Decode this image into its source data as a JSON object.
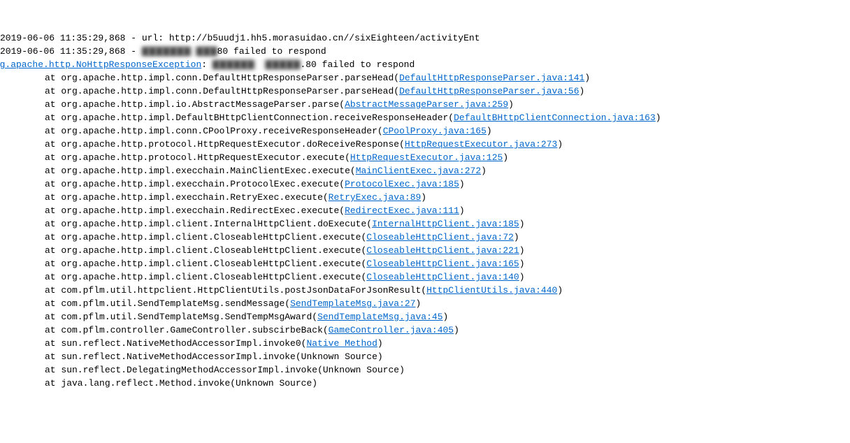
{
  "log": {
    "line0": {
      "text": "2019-06-06 11:35:29,868 - url: http://b5uudj1.hh5.morasuidao.cn//sixEighteen/activityEnt"
    },
    "line1": {
      "prefix": "2019-06-06 11:35:29,868 - ",
      "masked": "▇▇▇▇▇▇▇ ▇▇▇",
      "suffix": "80 failed to respond"
    },
    "line2": {
      "exLink": "org.apache.http.NoHttpResponseException",
      "colon": ": ",
      "masked": "▇▇▇▇▇▇  ▇▇▇▇▇",
      "suffix": ".80 failed to respond"
    }
  },
  "stack": [
    {
      "pre": "at org.apache.http.impl.conn.DefaultHttpResponseParser.parseHead(",
      "link": "DefaultHttpResponseParser.java:141",
      "post": ")"
    },
    {
      "pre": "at org.apache.http.impl.conn.DefaultHttpResponseParser.parseHead(",
      "link": "DefaultHttpResponseParser.java:56",
      "post": ")"
    },
    {
      "pre": "at org.apache.http.impl.io.AbstractMessageParser.parse(",
      "link": "AbstractMessageParser.java:259",
      "post": ")"
    },
    {
      "pre": "at org.apache.http.impl.DefaultBHttpClientConnection.receiveResponseHeader(",
      "link": "DefaultBHttpClientConnection.java:163",
      "post": ")"
    },
    {
      "pre": "at org.apache.http.impl.conn.CPoolProxy.receiveResponseHeader(",
      "link": "CPoolProxy.java:165",
      "post": ")"
    },
    {
      "pre": "at org.apache.http.protocol.HttpRequestExecutor.doReceiveResponse(",
      "link": "HttpRequestExecutor.java:273",
      "post": ")"
    },
    {
      "pre": "at org.apache.http.protocol.HttpRequestExecutor.execute(",
      "link": "HttpRequestExecutor.java:125",
      "post": ")"
    },
    {
      "pre": "at org.apache.http.impl.execchain.MainClientExec.execute(",
      "link": "MainClientExec.java:272",
      "post": ")"
    },
    {
      "pre": "at org.apache.http.impl.execchain.ProtocolExec.execute(",
      "link": "ProtocolExec.java:185",
      "post": ")"
    },
    {
      "pre": "at org.apache.http.impl.execchain.RetryExec.execute(",
      "link": "RetryExec.java:89",
      "post": ")"
    },
    {
      "pre": "at org.apache.http.impl.execchain.RedirectExec.execute(",
      "link": "RedirectExec.java:111",
      "post": ")"
    },
    {
      "pre": "at org.apache.http.impl.client.InternalHttpClient.doExecute(",
      "link": "InternalHttpClient.java:185",
      "post": ")"
    },
    {
      "pre": "at org.apache.http.impl.client.CloseableHttpClient.execute(",
      "link": "CloseableHttpClient.java:72",
      "post": ")"
    },
    {
      "pre": "at org.apache.http.impl.client.CloseableHttpClient.execute(",
      "link": "CloseableHttpClient.java:221",
      "post": ")"
    },
    {
      "pre": "at org.apache.http.impl.client.CloseableHttpClient.execute(",
      "link": "CloseableHttpClient.java:165",
      "post": ")"
    },
    {
      "pre": "at org.apache.http.impl.client.CloseableHttpClient.execute(",
      "link": "CloseableHttpClient.java:140",
      "post": ")"
    },
    {
      "pre": "at com.pflm.util.httpclient.HttpClientUtils.postJsonDataForJsonResult(",
      "link": "HttpClientUtils.java:440",
      "post": ")"
    },
    {
      "pre": "at com.pflm.util.SendTemplateMsg.sendMessage(",
      "link": "SendTemplateMsg.java:27",
      "post": ")"
    },
    {
      "pre": "at com.pflm.util.SendTemplateMsg.SendTempMsgAward(",
      "link": "SendTemplateMsg.java:45",
      "post": ")"
    },
    {
      "pre": "at com.pflm.controller.GameController.subscirbeBack(",
      "link": "GameController.java:405",
      "post": ")"
    },
    {
      "pre": "at sun.reflect.NativeMethodAccessorImpl.invoke0(",
      "link": "Native Method",
      "post": ")"
    },
    {
      "pre": "at sun.reflect.NativeMethodAccessorImpl.invoke(Unknown Source)",
      "link": "",
      "post": ""
    },
    {
      "pre": "at sun.reflect.DelegatingMethodAccessorImpl.invoke(Unknown Source)",
      "link": "",
      "post": ""
    },
    {
      "pre": "at java.lang.reflect.Method.invoke(Unknown Source)",
      "link": "",
      "post": ""
    }
  ]
}
